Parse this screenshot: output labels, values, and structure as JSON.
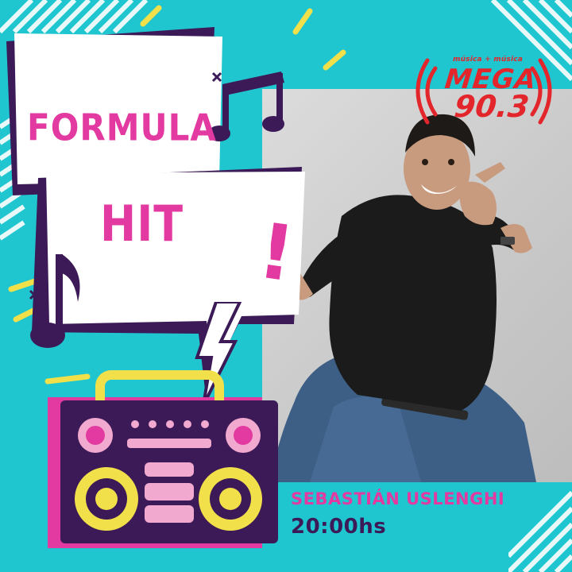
{
  "title": {
    "line1": "FORMULA",
    "line2": "HIT",
    "exclamation": "!"
  },
  "logo": {
    "tagline": "música + música",
    "brand": "MEGA",
    "frequency": "90.3"
  },
  "show": {
    "host": "SEBASTIÁN USLENGHI",
    "time": "20:00hs"
  },
  "colors": {
    "background": "#20c6cf",
    "accent_pink": "#e23aa0",
    "dark_purple": "#3b1a57",
    "yellow": "#f2e04a",
    "logo_red": "#e3262c"
  }
}
